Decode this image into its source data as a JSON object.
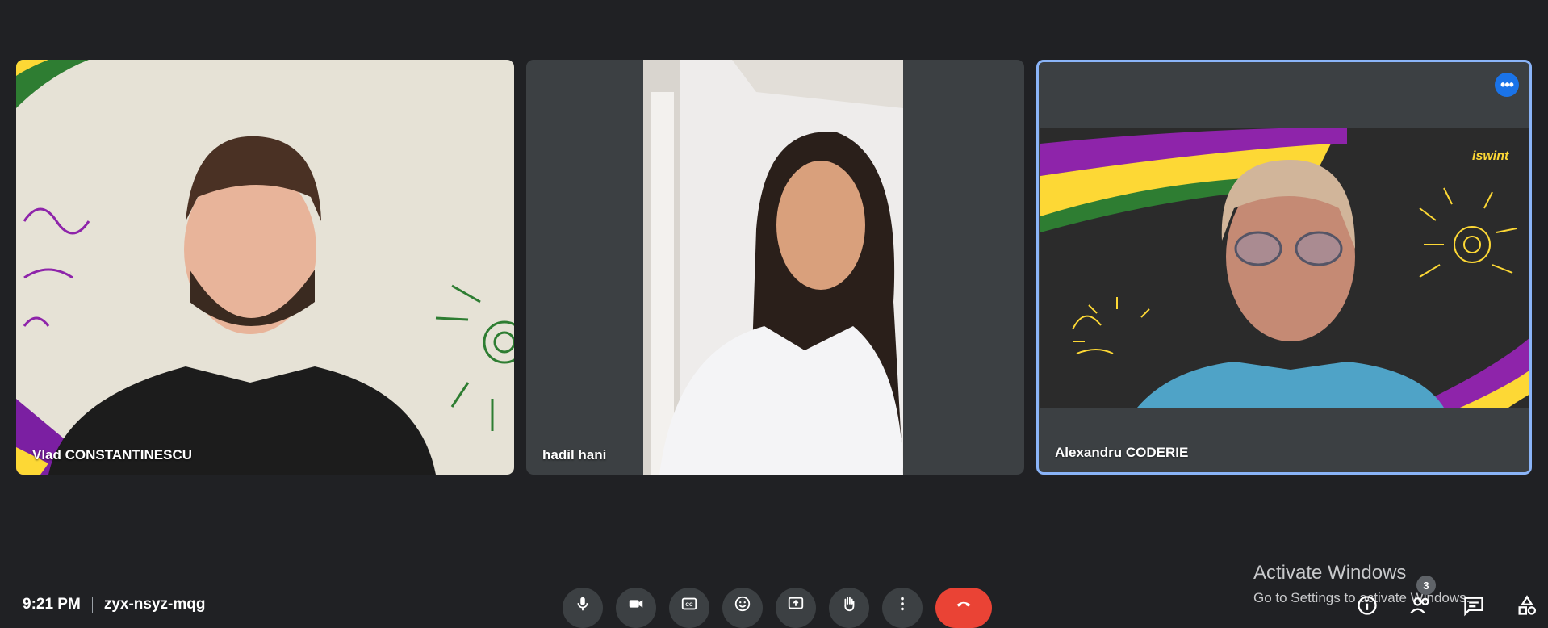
{
  "participants": [
    {
      "name": "Vlad CONSTANTINESCU"
    },
    {
      "name": "hadil hani"
    },
    {
      "name": "Alexandru CODERIE"
    }
  ],
  "tile3_more_label": "•••",
  "meeting": {
    "time": "9:21 PM",
    "code": "zyx-nsyz-mqg"
  },
  "controls": [
    {
      "icon": "microphone-icon"
    },
    {
      "icon": "camera-icon"
    },
    {
      "icon": "captions-icon"
    },
    {
      "icon": "emoji-icon"
    },
    {
      "icon": "present-screen-icon"
    },
    {
      "icon": "raise-hand-icon"
    },
    {
      "icon": "more-options-icon"
    },
    {
      "icon": "end-call-icon"
    }
  ],
  "watermark": {
    "line1": "Activate Windows",
    "line2": "Go to Settings to activate Windows."
  },
  "people_count": "3",
  "colors": {
    "background": "#202124",
    "tile": "#3c4043",
    "active_border": "#8ab4f8",
    "end_call": "#ea4335",
    "accent": "#1a73e8"
  }
}
